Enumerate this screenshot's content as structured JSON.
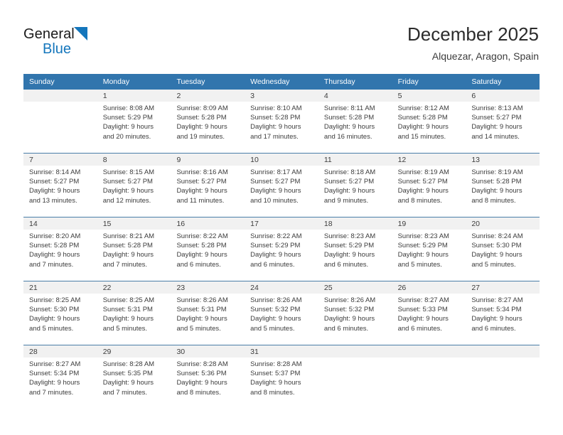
{
  "logo": {
    "word_top": "General",
    "word_bottom": "Blue",
    "triangle_icon": "triangle-icon",
    "blue": "#1476bc"
  },
  "header": {
    "title": "December 2025",
    "subtitle": "Alquezar, Aragon, Spain"
  },
  "colors": {
    "header_blue": "#3175ad",
    "row_divider": "#4a7ea8",
    "date_strip": "#f1f1f1",
    "text": "#3c3c3c"
  },
  "weekdays": [
    "Sunday",
    "Monday",
    "Tuesday",
    "Wednesday",
    "Thursday",
    "Friday",
    "Saturday"
  ],
  "weeks": [
    [
      {
        "day": "",
        "sunrise": "",
        "sunset": "",
        "daylight1": "",
        "daylight2": ""
      },
      {
        "day": "1",
        "sunrise": "Sunrise: 8:08 AM",
        "sunset": "Sunset: 5:29 PM",
        "daylight1": "Daylight: 9 hours",
        "daylight2": "and 20 minutes."
      },
      {
        "day": "2",
        "sunrise": "Sunrise: 8:09 AM",
        "sunset": "Sunset: 5:28 PM",
        "daylight1": "Daylight: 9 hours",
        "daylight2": "and 19 minutes."
      },
      {
        "day": "3",
        "sunrise": "Sunrise: 8:10 AM",
        "sunset": "Sunset: 5:28 PM",
        "daylight1": "Daylight: 9 hours",
        "daylight2": "and 17 minutes."
      },
      {
        "day": "4",
        "sunrise": "Sunrise: 8:11 AM",
        "sunset": "Sunset: 5:28 PM",
        "daylight1": "Daylight: 9 hours",
        "daylight2": "and 16 minutes."
      },
      {
        "day": "5",
        "sunrise": "Sunrise: 8:12 AM",
        "sunset": "Sunset: 5:28 PM",
        "daylight1": "Daylight: 9 hours",
        "daylight2": "and 15 minutes."
      },
      {
        "day": "6",
        "sunrise": "Sunrise: 8:13 AM",
        "sunset": "Sunset: 5:27 PM",
        "daylight1": "Daylight: 9 hours",
        "daylight2": "and 14 minutes."
      }
    ],
    [
      {
        "day": "7",
        "sunrise": "Sunrise: 8:14 AM",
        "sunset": "Sunset: 5:27 PM",
        "daylight1": "Daylight: 9 hours",
        "daylight2": "and 13 minutes."
      },
      {
        "day": "8",
        "sunrise": "Sunrise: 8:15 AM",
        "sunset": "Sunset: 5:27 PM",
        "daylight1": "Daylight: 9 hours",
        "daylight2": "and 12 minutes."
      },
      {
        "day": "9",
        "sunrise": "Sunrise: 8:16 AM",
        "sunset": "Sunset: 5:27 PM",
        "daylight1": "Daylight: 9 hours",
        "daylight2": "and 11 minutes."
      },
      {
        "day": "10",
        "sunrise": "Sunrise: 8:17 AM",
        "sunset": "Sunset: 5:27 PM",
        "daylight1": "Daylight: 9 hours",
        "daylight2": "and 10 minutes."
      },
      {
        "day": "11",
        "sunrise": "Sunrise: 8:18 AM",
        "sunset": "Sunset: 5:27 PM",
        "daylight1": "Daylight: 9 hours",
        "daylight2": "and 9 minutes."
      },
      {
        "day": "12",
        "sunrise": "Sunrise: 8:19 AM",
        "sunset": "Sunset: 5:27 PM",
        "daylight1": "Daylight: 9 hours",
        "daylight2": "and 8 minutes."
      },
      {
        "day": "13",
        "sunrise": "Sunrise: 8:19 AM",
        "sunset": "Sunset: 5:28 PM",
        "daylight1": "Daylight: 9 hours",
        "daylight2": "and 8 minutes."
      }
    ],
    [
      {
        "day": "14",
        "sunrise": "Sunrise: 8:20 AM",
        "sunset": "Sunset: 5:28 PM",
        "daylight1": "Daylight: 9 hours",
        "daylight2": "and 7 minutes."
      },
      {
        "day": "15",
        "sunrise": "Sunrise: 8:21 AM",
        "sunset": "Sunset: 5:28 PM",
        "daylight1": "Daylight: 9 hours",
        "daylight2": "and 7 minutes."
      },
      {
        "day": "16",
        "sunrise": "Sunrise: 8:22 AM",
        "sunset": "Sunset: 5:28 PM",
        "daylight1": "Daylight: 9 hours",
        "daylight2": "and 6 minutes."
      },
      {
        "day": "17",
        "sunrise": "Sunrise: 8:22 AM",
        "sunset": "Sunset: 5:29 PM",
        "daylight1": "Daylight: 9 hours",
        "daylight2": "and 6 minutes."
      },
      {
        "day": "18",
        "sunrise": "Sunrise: 8:23 AM",
        "sunset": "Sunset: 5:29 PM",
        "daylight1": "Daylight: 9 hours",
        "daylight2": "and 6 minutes."
      },
      {
        "day": "19",
        "sunrise": "Sunrise: 8:23 AM",
        "sunset": "Sunset: 5:29 PM",
        "daylight1": "Daylight: 9 hours",
        "daylight2": "and 5 minutes."
      },
      {
        "day": "20",
        "sunrise": "Sunrise: 8:24 AM",
        "sunset": "Sunset: 5:30 PM",
        "daylight1": "Daylight: 9 hours",
        "daylight2": "and 5 minutes."
      }
    ],
    [
      {
        "day": "21",
        "sunrise": "Sunrise: 8:25 AM",
        "sunset": "Sunset: 5:30 PM",
        "daylight1": "Daylight: 9 hours",
        "daylight2": "and 5 minutes."
      },
      {
        "day": "22",
        "sunrise": "Sunrise: 8:25 AM",
        "sunset": "Sunset: 5:31 PM",
        "daylight1": "Daylight: 9 hours",
        "daylight2": "and 5 minutes."
      },
      {
        "day": "23",
        "sunrise": "Sunrise: 8:26 AM",
        "sunset": "Sunset: 5:31 PM",
        "daylight1": "Daylight: 9 hours",
        "daylight2": "and 5 minutes."
      },
      {
        "day": "24",
        "sunrise": "Sunrise: 8:26 AM",
        "sunset": "Sunset: 5:32 PM",
        "daylight1": "Daylight: 9 hours",
        "daylight2": "and 5 minutes."
      },
      {
        "day": "25",
        "sunrise": "Sunrise: 8:26 AM",
        "sunset": "Sunset: 5:32 PM",
        "daylight1": "Daylight: 9 hours",
        "daylight2": "and 6 minutes."
      },
      {
        "day": "26",
        "sunrise": "Sunrise: 8:27 AM",
        "sunset": "Sunset: 5:33 PM",
        "daylight1": "Daylight: 9 hours",
        "daylight2": "and 6 minutes."
      },
      {
        "day": "27",
        "sunrise": "Sunrise: 8:27 AM",
        "sunset": "Sunset: 5:34 PM",
        "daylight1": "Daylight: 9 hours",
        "daylight2": "and 6 minutes."
      }
    ],
    [
      {
        "day": "28",
        "sunrise": "Sunrise: 8:27 AM",
        "sunset": "Sunset: 5:34 PM",
        "daylight1": "Daylight: 9 hours",
        "daylight2": "and 7 minutes."
      },
      {
        "day": "29",
        "sunrise": "Sunrise: 8:28 AM",
        "sunset": "Sunset: 5:35 PM",
        "daylight1": "Daylight: 9 hours",
        "daylight2": "and 7 minutes."
      },
      {
        "day": "30",
        "sunrise": "Sunrise: 8:28 AM",
        "sunset": "Sunset: 5:36 PM",
        "daylight1": "Daylight: 9 hours",
        "daylight2": "and 8 minutes."
      },
      {
        "day": "31",
        "sunrise": "Sunrise: 8:28 AM",
        "sunset": "Sunset: 5:37 PM",
        "daylight1": "Daylight: 9 hours",
        "daylight2": "and 8 minutes."
      },
      {
        "day": "",
        "sunrise": "",
        "sunset": "",
        "daylight1": "",
        "daylight2": ""
      },
      {
        "day": "",
        "sunrise": "",
        "sunset": "",
        "daylight1": "",
        "daylight2": ""
      },
      {
        "day": "",
        "sunrise": "",
        "sunset": "",
        "daylight1": "",
        "daylight2": ""
      }
    ]
  ]
}
